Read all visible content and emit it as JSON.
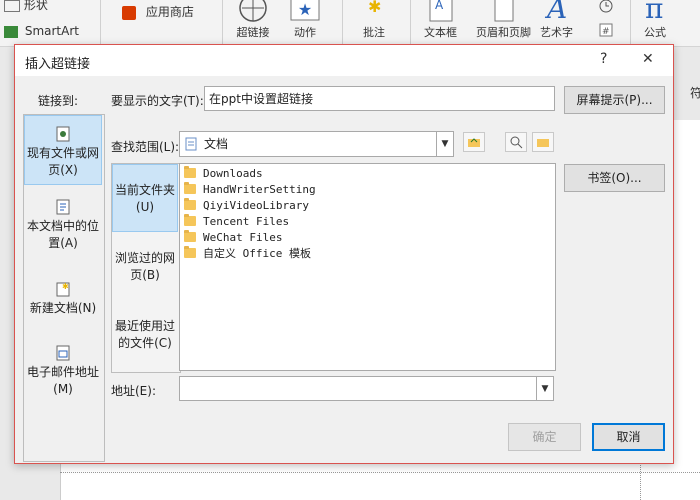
{
  "ribbon": {
    "shapes_label": "形状",
    "smartart_label": "SmartArt",
    "store_label": "应用商店",
    "hyperlink_label": "超链接",
    "action_label": "动作",
    "comment_label": "批注",
    "textbox_label": "文本框",
    "header_footer_label": "页眉和页脚",
    "wordart_label": "艺术字",
    "equation_label": "公式",
    "right_edge_label": "符"
  },
  "dialog": {
    "title": "插入超链接",
    "help_label": "?",
    "close_label": "✕",
    "link_to_label": "链接到:",
    "link_to_items": [
      {
        "label": "现有文件或网页(X)",
        "icon": "existing-file-icon",
        "selected": true
      },
      {
        "label": "本文档中的位置(A)",
        "icon": "document-place-icon",
        "selected": false
      },
      {
        "label": "新建文档(N)",
        "icon": "new-document-icon",
        "selected": false
      },
      {
        "label": "电子邮件地址(M)",
        "icon": "email-icon",
        "selected": false
      }
    ],
    "display_text_label": "要显示的文字(T):",
    "display_text_value": "在ppt中设置超链接",
    "screentip_label": "屏幕提示(P)...",
    "look_in_label": "查找范围(L):",
    "look_in_value": "文档",
    "bookmark_label": "书签(O)...",
    "nav_items": [
      {
        "label": "当前文件夹(U)",
        "selected": true
      },
      {
        "label": "浏览过的网页(B)",
        "selected": false
      },
      {
        "label": "最近使用过的文件(C)",
        "selected": false
      }
    ],
    "files": [
      "Downloads",
      "HandWriterSetting",
      "QiyiVideoLibrary",
      "Tencent Files",
      "WeChat Files",
      "自定义 Office 模板"
    ],
    "address_label": "地址(E):",
    "address_value": "",
    "ok_label": "确定",
    "cancel_label": "取消"
  },
  "colors": {
    "dialog_border": "#d9534f",
    "selection_bg": "#cce4f7",
    "folder": "#f5c65a",
    "focus_border": "#0078d7"
  }
}
